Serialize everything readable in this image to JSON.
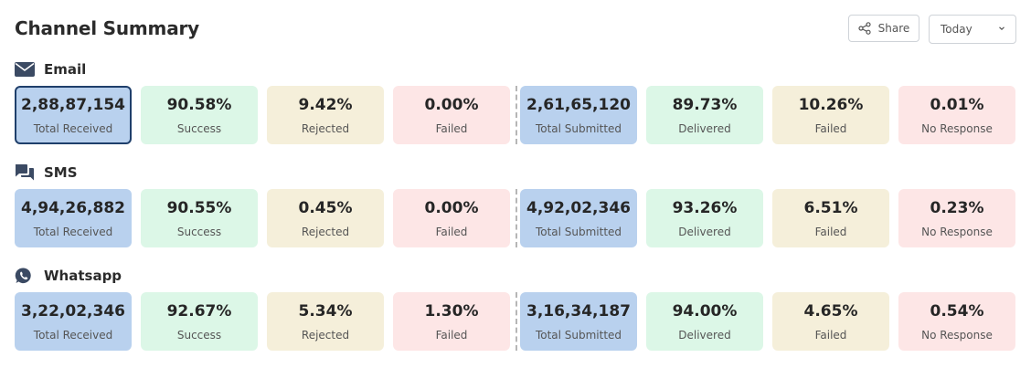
{
  "header": {
    "title": "Channel Summary",
    "share_label": "Share",
    "range_value": "Today"
  },
  "colors": {
    "blue": "#b9d1ee",
    "green": "#dcf7e7",
    "beige": "#f5efda",
    "pink": "#fde6e6",
    "icon": "#3b4a63"
  },
  "sections": [
    {
      "name": "Email",
      "icon": "mail-icon",
      "tiles": [
        {
          "value": "2,88,87,154",
          "label": "Total Received"
        },
        {
          "value": "90.58%",
          "label": "Success"
        },
        {
          "value": "9.42%",
          "label": "Rejected"
        },
        {
          "value": "0.00%",
          "label": "Failed"
        },
        {
          "value": "2,61,65,120",
          "label": "Total Submitted"
        },
        {
          "value": "89.73%",
          "label": "Delivered"
        },
        {
          "value": "10.26%",
          "label": "Failed"
        },
        {
          "value": "0.01%",
          "label": "No Response"
        }
      ]
    },
    {
      "name": "SMS",
      "icon": "chat-icon",
      "tiles": [
        {
          "value": "4,94,26,882",
          "label": "Total Received"
        },
        {
          "value": "90.55%",
          "label": "Success"
        },
        {
          "value": "0.45%",
          "label": "Rejected"
        },
        {
          "value": "0.00%",
          "label": "Failed"
        },
        {
          "value": "4,92,02,346",
          "label": "Total Submitted"
        },
        {
          "value": "93.26%",
          "label": "Delivered"
        },
        {
          "value": "6.51%",
          "label": "Failed"
        },
        {
          "value": "0.23%",
          "label": "No Response"
        }
      ]
    },
    {
      "name": "Whatsapp",
      "icon": "whatsapp-icon",
      "tiles": [
        {
          "value": "3,22,02,346",
          "label": "Total Received"
        },
        {
          "value": "92.67%",
          "label": "Success"
        },
        {
          "value": "5.34%",
          "label": "Rejected"
        },
        {
          "value": "1.30%",
          "label": "Failed"
        },
        {
          "value": "3,16,34,187",
          "label": "Total Submitted"
        },
        {
          "value": "94.00%",
          "label": "Delivered"
        },
        {
          "value": "4.65%",
          "label": "Failed"
        },
        {
          "value": "0.54%",
          "label": "No Response"
        }
      ]
    }
  ]
}
